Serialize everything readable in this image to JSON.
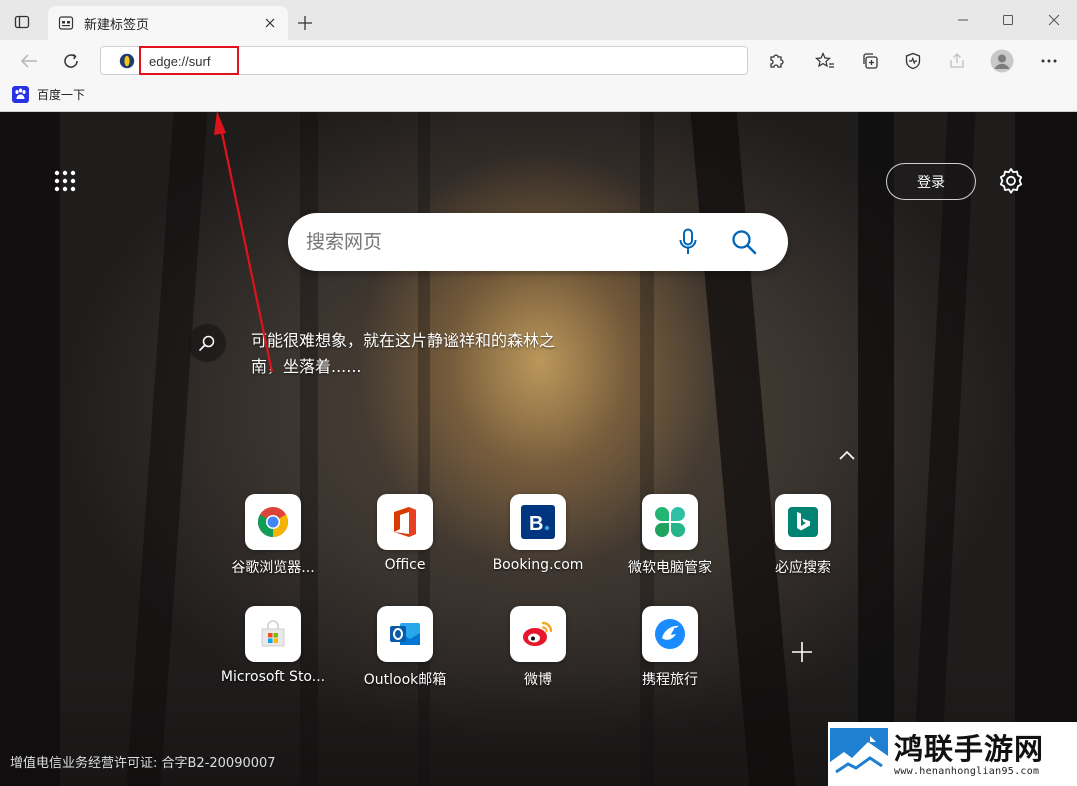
{
  "tab": {
    "title": "新建标签页"
  },
  "address": {
    "value": "edge://surf"
  },
  "bookmarks": [
    {
      "label": "百度一下"
    }
  ],
  "page": {
    "login_label": "登录",
    "search_placeholder": "搜索网页",
    "caption": "可能很难想象，就在这片静谧祥和的森林之南，坐落着......",
    "license": "增值电信业务经营许可证: 合字B2-20090007"
  },
  "tiles": [
    {
      "label": "谷歌浏览器...",
      "icon": "chrome-icon"
    },
    {
      "label": "Office",
      "icon": "office-icon"
    },
    {
      "label": "Booking.com",
      "icon": "booking-icon"
    },
    {
      "label": "微软电脑管家",
      "icon": "pc-manager-icon"
    },
    {
      "label": "必应搜索",
      "icon": "bing-icon"
    },
    {
      "label": "Microsoft Sto...",
      "icon": "microsoft-store-icon"
    },
    {
      "label": "Outlook邮箱",
      "icon": "outlook-icon"
    },
    {
      "label": "微博",
      "icon": "weibo-icon"
    },
    {
      "label": "携程旅行",
      "icon": "ctrip-icon"
    }
  ],
  "watermark": {
    "name": "鸿联手游网",
    "url": "www.henanhonglian95.com"
  },
  "colors": {
    "annotation": "#e0121b",
    "accent": "#0067b8"
  }
}
